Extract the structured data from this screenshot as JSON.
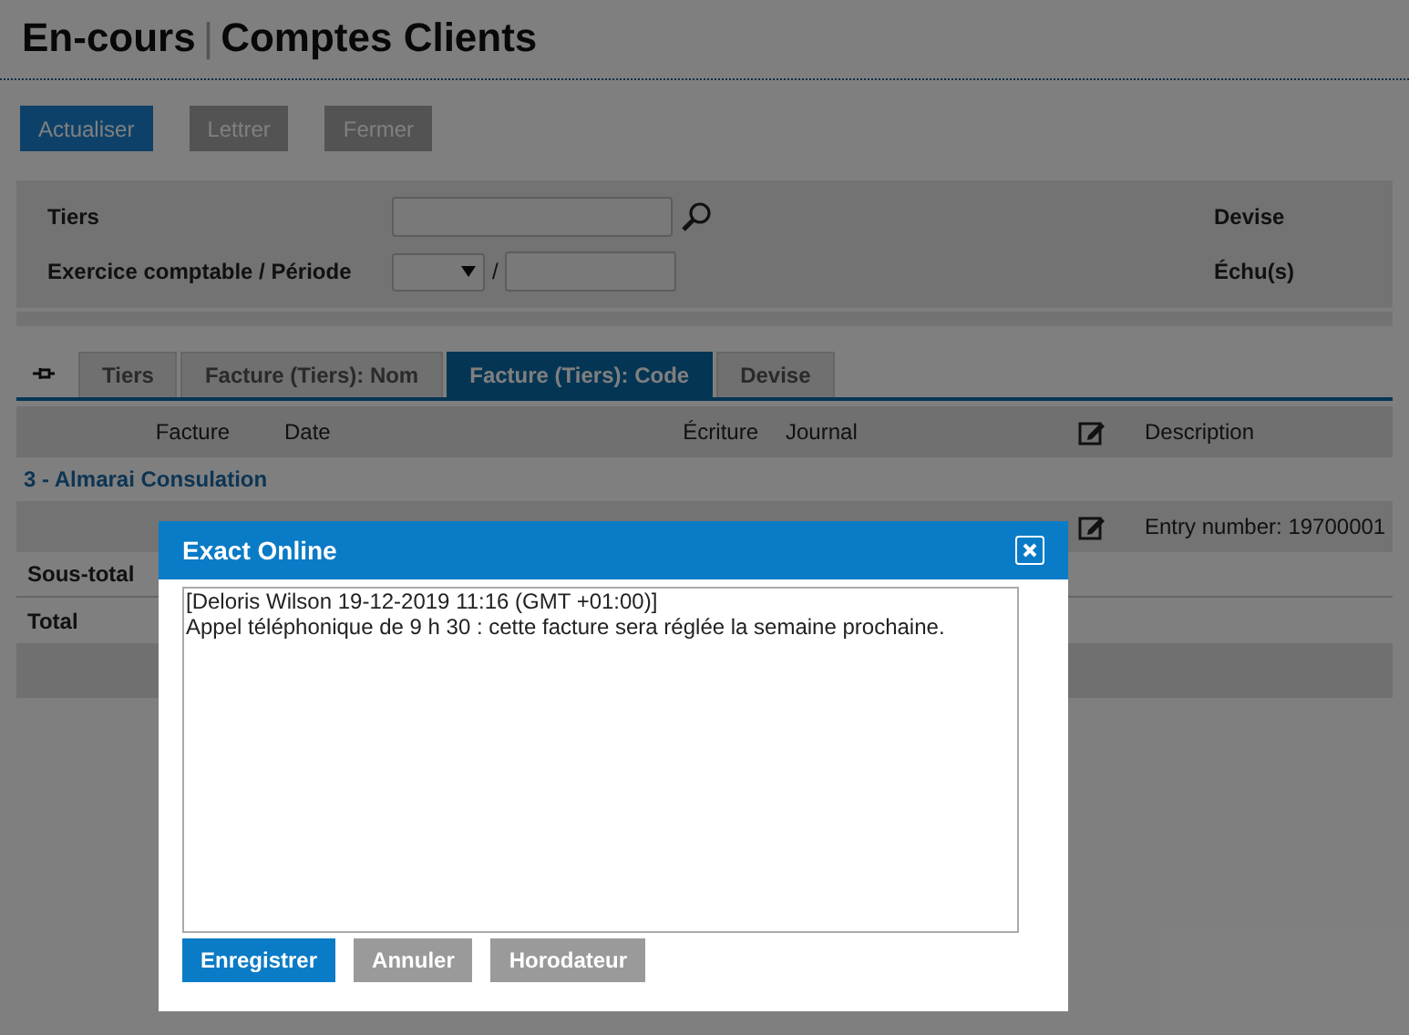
{
  "page_title": {
    "primary": "En-cours",
    "separator": "|",
    "secondary": "Comptes Clients"
  },
  "toolbar": [
    {
      "label": "Actualiser",
      "kind": "primary"
    },
    {
      "label": "Lettrer",
      "kind": "secondary"
    },
    {
      "label": "Fermer",
      "kind": "secondary"
    }
  ],
  "filters": {
    "tiers_label": "Tiers",
    "period_label": "Exercice comptable / Période",
    "period_separator": "/",
    "right_labels": [
      "Devise",
      "Échu(s)"
    ]
  },
  "tabs": [
    {
      "label": "Tiers",
      "selected": false
    },
    {
      "label": "Facture (Tiers): Nom",
      "selected": false
    },
    {
      "label": "Facture (Tiers): Code",
      "selected": true
    },
    {
      "label": "Devise",
      "selected": false
    }
  ],
  "table": {
    "columns": [
      {
        "kind": "text",
        "label": "Facture"
      },
      {
        "kind": "text",
        "label": "Date"
      },
      {
        "kind": "text",
        "label": "Écriture"
      },
      {
        "kind": "text",
        "label": "Journal"
      },
      {
        "kind": "icon"
      },
      {
        "kind": "text",
        "label": "Description"
      }
    ],
    "group": "3 - Almarai Consulation",
    "rows": [
      {
        "description": "Entry number: 19700001"
      }
    ],
    "subtotal_label": "Sous-total",
    "total_label": "Total"
  },
  "dialog": {
    "title": "Exact Online",
    "note": "[Deloris Wilson 19-12-2019 11:16 (GMT +01:00)]\nAppel téléphonique de 9 h 30 : cette facture sera réglée la semaine prochaine.",
    "buttons": [
      {
        "label": "Enregistrer",
        "kind": "primary"
      },
      {
        "label": "Annuler",
        "kind": "secondary"
      },
      {
        "label": "Horodateur",
        "kind": "secondary"
      }
    ]
  }
}
